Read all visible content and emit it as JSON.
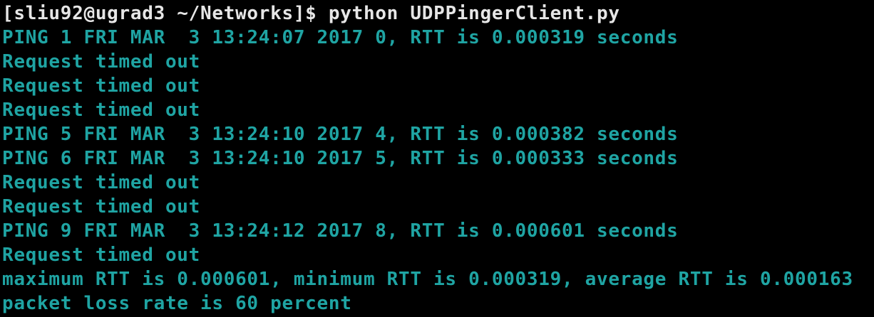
{
  "terminal": {
    "prompt": "[sliu92@ugrad3 ~/Networks]$ ",
    "command": "python UDPPingerClient.py",
    "lines": [
      "PING 1 FRI MAR  3 13:24:07 2017 0, RTT is 0.000319 seconds",
      "Request timed out",
      "Request timed out",
      "Request timed out",
      "PING 5 FRI MAR  3 13:24:10 2017 4, RTT is 0.000382 seconds",
      "PING 6 FRI MAR  3 13:24:10 2017 5, RTT is 0.000333 seconds",
      "Request timed out",
      "Request timed out",
      "PING 9 FRI MAR  3 13:24:12 2017 8, RTT is 0.000601 seconds",
      "Request timed out",
      "maximum RTT is 0.000601, minimum RTT is 0.000319, average RTT is 0.000163",
      "packet loss rate is 60 percent"
    ]
  },
  "colors": {
    "background": "#000000",
    "prompt_text": "#e6e6e6",
    "output_text": "#1fa4a3"
  }
}
